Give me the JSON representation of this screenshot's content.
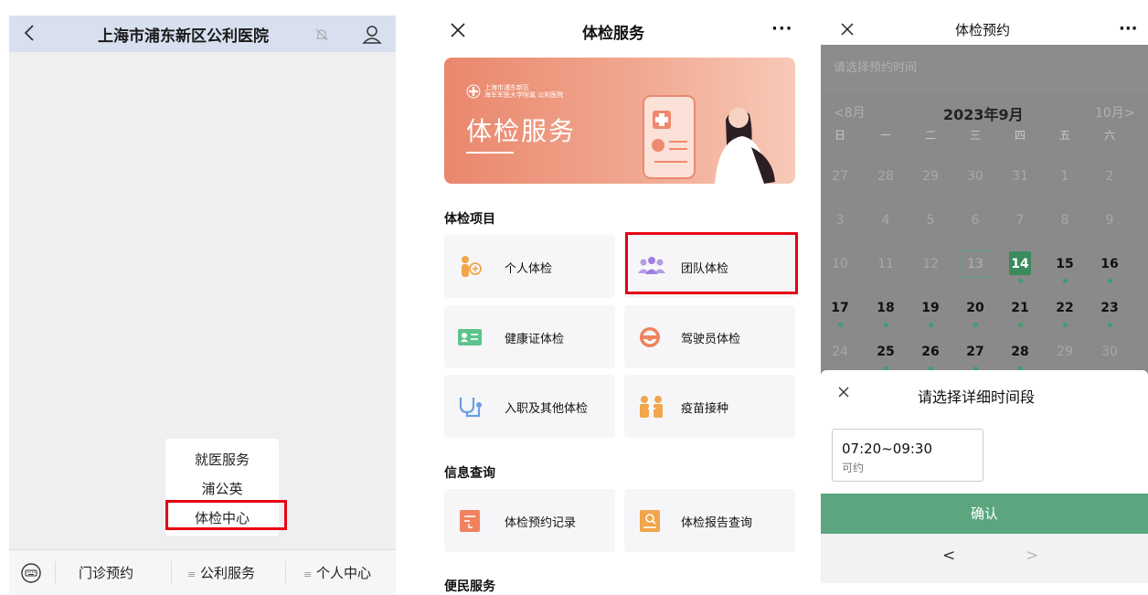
{
  "panel1": {
    "title": "上海市浦东新区公利医院",
    "popup_items": [
      "就医服务",
      "浦公英",
      "体检中心"
    ],
    "tabs": [
      "门诊预约",
      "公利服务",
      "个人中心"
    ],
    "tab_menu_marker": "≡"
  },
  "panel2": {
    "title": "体检服务",
    "more": "···",
    "banner": {
      "logo_line1": "上海市浦东新区",
      "logo_line2": "海军军医大学附属 公利医院",
      "title": "体检服务"
    },
    "sections": {
      "exam": "体检项目",
      "info": "信息查询",
      "convenience": "便民服务"
    },
    "exam_items": [
      "个人体检",
      "团队体检",
      "健康证体检",
      "驾驶员体检",
      "入职及其他体检",
      "疫苗接种"
    ],
    "info_items": [
      "体检预约记录",
      "体检报告查询"
    ]
  },
  "panel3": {
    "title": "体检预约",
    "more": "···",
    "hint": "请选择预约时间",
    "prev_month": "<8月",
    "current_month": "2023年9月",
    "next_month": "10月>",
    "weekdays": [
      "日",
      "一",
      "二",
      "三",
      "四",
      "五",
      "六"
    ],
    "calendar_rows": [
      [
        "27",
        "28",
        "29",
        "30",
        "31",
        "1",
        "2"
      ],
      [
        "3",
        "4",
        "5",
        "6",
        "7",
        "8",
        "9"
      ],
      [
        "10",
        "11",
        "12",
        "13",
        "14",
        "15",
        "16"
      ],
      [
        "17",
        "18",
        "19",
        "20",
        "21",
        "22",
        "23"
      ],
      [
        "24",
        "25",
        "26",
        "27",
        "28",
        "29",
        "30"
      ]
    ],
    "available_days": [
      "15",
      "16",
      "17",
      "18",
      "19",
      "20",
      "21",
      "22",
      "23",
      "25",
      "26",
      "27",
      "28"
    ],
    "today": "13",
    "selected_day": "14",
    "sheet_title": "请选择详细时间段",
    "slot_time": "07:20~09:30",
    "slot_status": "可约",
    "confirm": "确认",
    "page_prev": "<",
    "page_next": ">",
    "colors": {
      "accent": "#5ba57f",
      "highlight": "#e60012"
    }
  }
}
